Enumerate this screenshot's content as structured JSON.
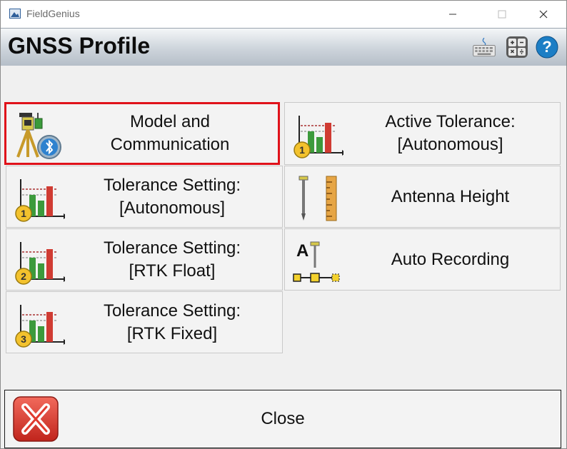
{
  "window": {
    "title": "FieldGenius"
  },
  "header": {
    "title": "GNSS Profile"
  },
  "icons": {
    "app": "app-icon",
    "minimize": "minimize-icon",
    "maximize": "maximize-icon",
    "close": "close-icon",
    "keyboard": "keyboard-icon",
    "calculator": "calculator-icon",
    "help": "help-icon"
  },
  "buttons": {
    "model": {
      "line1": "Model and",
      "line2": "Communication"
    },
    "active_tolerance": {
      "line1": "Active Tolerance:",
      "line2": "[Autonomous]"
    },
    "tol_autonomous": {
      "line1": "Tolerance Setting:",
      "line2": "[Autonomous]"
    },
    "antenna_height": {
      "line1": "Antenna Height"
    },
    "tol_rtk_float": {
      "line1": "Tolerance Setting:",
      "line2": "[RTK Float]"
    },
    "auto_recording": {
      "line1": "Auto Recording"
    },
    "tol_rtk_fixed": {
      "line1": "Tolerance Setting:",
      "line2": "[RTK Fixed]"
    },
    "close": {
      "label": "Close"
    }
  },
  "badges": {
    "one": "1",
    "two": "2",
    "three": "3"
  },
  "auto_recording_icon_letter": "A",
  "colors": {
    "selection_border": "#e0121a",
    "close_icon": "#d8302c",
    "help_icon": "#1c7ec5"
  }
}
